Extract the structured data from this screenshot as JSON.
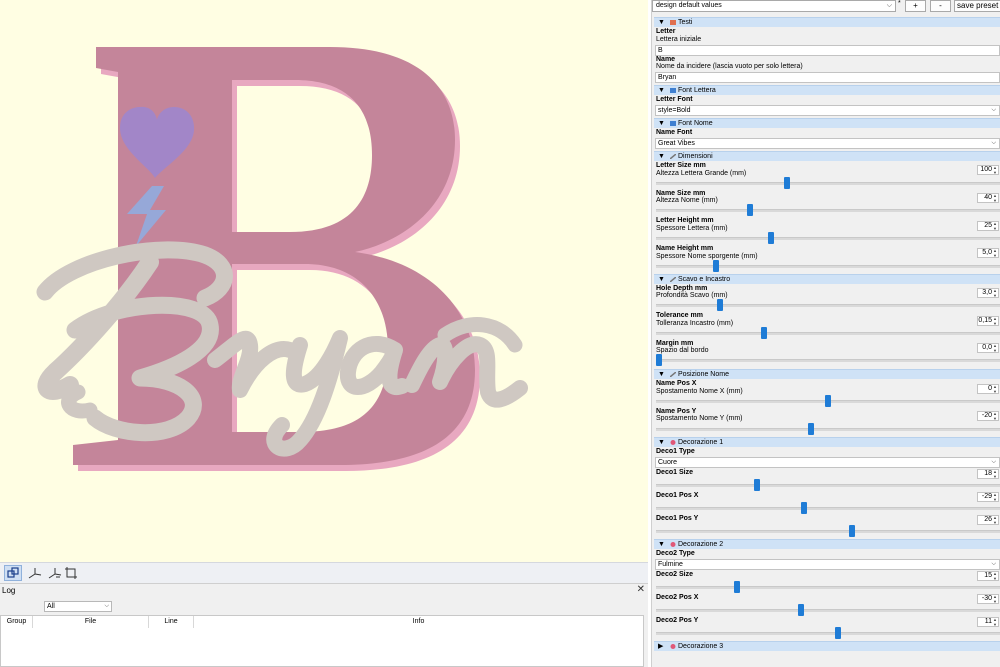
{
  "toolbar": {
    "preset_value": "design default values",
    "star": "*",
    "plus": "+",
    "minus": "-",
    "save_preset": "save preset"
  },
  "log": {
    "title": "Log",
    "filter_value": "All",
    "columns": [
      "Group",
      "File",
      "Line",
      "Info"
    ]
  },
  "model": {
    "letter": "B",
    "name": "Bryan",
    "colors": {
      "letter": "#c4859a",
      "name": "#cfc8c2",
      "heart": "#a286c8",
      "bolt": "#96a8d8",
      "viewport_bg": "#fffee3"
    }
  },
  "sections": {
    "testi": "Testi",
    "font_lettera": "Font Lettera",
    "font_nome": "Font Nome",
    "dimensioni": "Dimensioni",
    "scavo": "Scavo e Incastro",
    "posizione": "Posizione Nome",
    "deco1": "Decorazione 1",
    "deco2": "Decorazione 2",
    "deco3": "Decorazione 3"
  },
  "fields": {
    "letter": {
      "label": "Letter",
      "desc": "Lettera iniziale",
      "value": "B"
    },
    "name": {
      "label": "Name",
      "desc": "Nome da incidere (lascia vuoto per solo lettera)",
      "value": "Bryan"
    },
    "letter_font": {
      "label": "Letter Font",
      "value": "style=Bold"
    },
    "name_font": {
      "label": "Name Font",
      "value": "Great Vibes"
    },
    "letter_size": {
      "label": "Letter Size mm",
      "desc": "Altezza Lettera Grande (mm)",
      "value": "100",
      "slider": 0.38
    },
    "name_size": {
      "label": "Name Size mm",
      "desc": "Altezza Nome (mm)",
      "value": "40",
      "slider": 0.27
    },
    "letter_height": {
      "label": "Letter Height mm",
      "desc": "Spessore Lettera (mm)",
      "value": "25",
      "slider": 0.33
    },
    "name_height": {
      "label": "Name Height mm",
      "desc": "Spessore Nome sporgente (mm)",
      "value": "5,0",
      "slider": 0.17
    },
    "hole_depth": {
      "label": "Hole Depth mm",
      "desc": "Profondità Scavo (mm)",
      "value": "3,0",
      "slider": 0.18
    },
    "tolerance": {
      "label": "Tolerance mm",
      "desc": "Tolleranza Incastro (mm)",
      "value": "0,15",
      "slider": 0.31
    },
    "margin": {
      "label": "Margin mm",
      "desc": "Spazio dal bordo",
      "value": "0,0",
      "slider": 0.0
    },
    "name_pos_x": {
      "label": "Name Pos X",
      "desc": "Spostamento Nome X (mm)",
      "value": "0",
      "slider": 0.5
    },
    "name_pos_y": {
      "label": "Name Pos Y",
      "desc": "Spostamento Nome Y (mm)",
      "value": "-20",
      "slider": 0.45
    },
    "deco1_type": {
      "label": "Deco1 Type",
      "value": "Cuore"
    },
    "deco1_size": {
      "label": "Deco1 Size",
      "value": "18",
      "slider": 0.29
    },
    "deco1_pos_x": {
      "label": "Deco1 Pos X",
      "value": "-29",
      "slider": 0.43
    },
    "deco1_pos_y": {
      "label": "Deco1 Pos Y",
      "value": "26",
      "slider": 0.57
    },
    "deco2_type": {
      "label": "Deco2 Type",
      "value": "Fulmine"
    },
    "deco2_size": {
      "label": "Deco2 Size",
      "value": "15",
      "slider": 0.23
    },
    "deco2_pos_x": {
      "label": "Deco2 Pos X",
      "value": "-30",
      "slider": 0.42
    },
    "deco2_pos_y": {
      "label": "Deco2 Pos Y",
      "value": "11",
      "slider": 0.53
    }
  }
}
